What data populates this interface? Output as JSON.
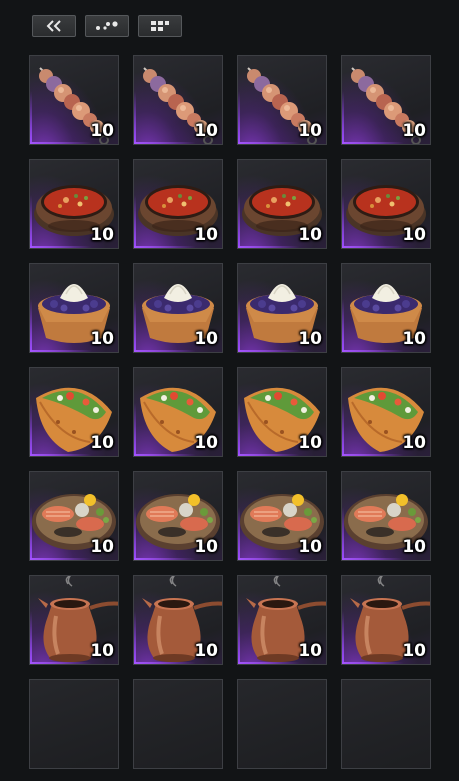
{
  "toolbar": {
    "buttons": [
      {
        "name": "collapse-button",
        "icon": "double-chevron-left-icon"
      },
      {
        "name": "sort-button",
        "icon": "scatter-dots-icon"
      },
      {
        "name": "grid-view-button",
        "icon": "grid-icon"
      }
    ]
  },
  "inventory": {
    "rows": [
      {
        "item": "skewer",
        "icon": "kebab-skewer-icon",
        "slots": [
          {
            "qty": "10"
          },
          {
            "qty": "10"
          },
          {
            "qty": "10"
          },
          {
            "qty": "10"
          }
        ]
      },
      {
        "item": "soup",
        "icon": "soup-pot-icon",
        "slots": [
          {
            "qty": "10"
          },
          {
            "qty": "10"
          },
          {
            "qty": "10"
          },
          {
            "qty": "10"
          }
        ]
      },
      {
        "item": "tart",
        "icon": "berry-tart-icon",
        "slots": [
          {
            "qty": "10"
          },
          {
            "qty": "10"
          },
          {
            "qty": "10"
          },
          {
            "qty": "10"
          }
        ]
      },
      {
        "item": "taco",
        "icon": "taco-icon",
        "slots": [
          {
            "qty": "10"
          },
          {
            "qty": "10"
          },
          {
            "qty": "10"
          },
          {
            "qty": "10"
          }
        ]
      },
      {
        "item": "fish-platter",
        "icon": "fish-platter-icon",
        "slots": [
          {
            "qty": "10"
          },
          {
            "qty": "10"
          },
          {
            "qty": "10"
          },
          {
            "qty": "10"
          }
        ]
      },
      {
        "item": "coffee-pot",
        "icon": "coffee-pot-icon",
        "slots": [
          {
            "qty": "10"
          },
          {
            "qty": "10"
          },
          {
            "qty": "10"
          },
          {
            "qty": "10"
          }
        ]
      }
    ],
    "empty_slots": 4
  },
  "colors": {
    "background": "#121416",
    "rarity_glow": "#9b4cff",
    "qty_text": "#ffffff"
  }
}
